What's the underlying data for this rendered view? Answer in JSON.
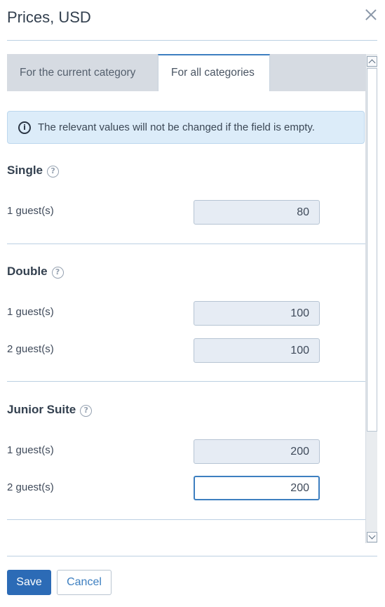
{
  "header": {
    "title": "Prices, USD"
  },
  "tabs": [
    {
      "label": "For the current category",
      "active": false
    },
    {
      "label": "For all categories",
      "active": true
    }
  ],
  "info": {
    "text": "The relevant values will not be changed if the field is empty."
  },
  "sections": [
    {
      "title": "Single",
      "rows": [
        {
          "label": "1 guest(s)",
          "value": "80"
        }
      ]
    },
    {
      "title": "Double",
      "rows": [
        {
          "label": "1 guest(s)",
          "value": "100"
        },
        {
          "label": "2 guest(s)",
          "value": "100"
        }
      ]
    },
    {
      "title": "Junior Suite",
      "rows": [
        {
          "label": "1 guest(s)",
          "value": "200"
        },
        {
          "label": "2 guest(s)",
          "value": "200"
        }
      ]
    }
  ],
  "footer": {
    "save_label": "Save",
    "cancel_label": "Cancel"
  },
  "icons": {
    "close": "close-icon",
    "info": "info-icon",
    "help": "help-icon"
  },
  "colors": {
    "accent": "#2c6bb6",
    "info_bg": "#dcecf9",
    "input_bg": "#e6ecf4"
  }
}
